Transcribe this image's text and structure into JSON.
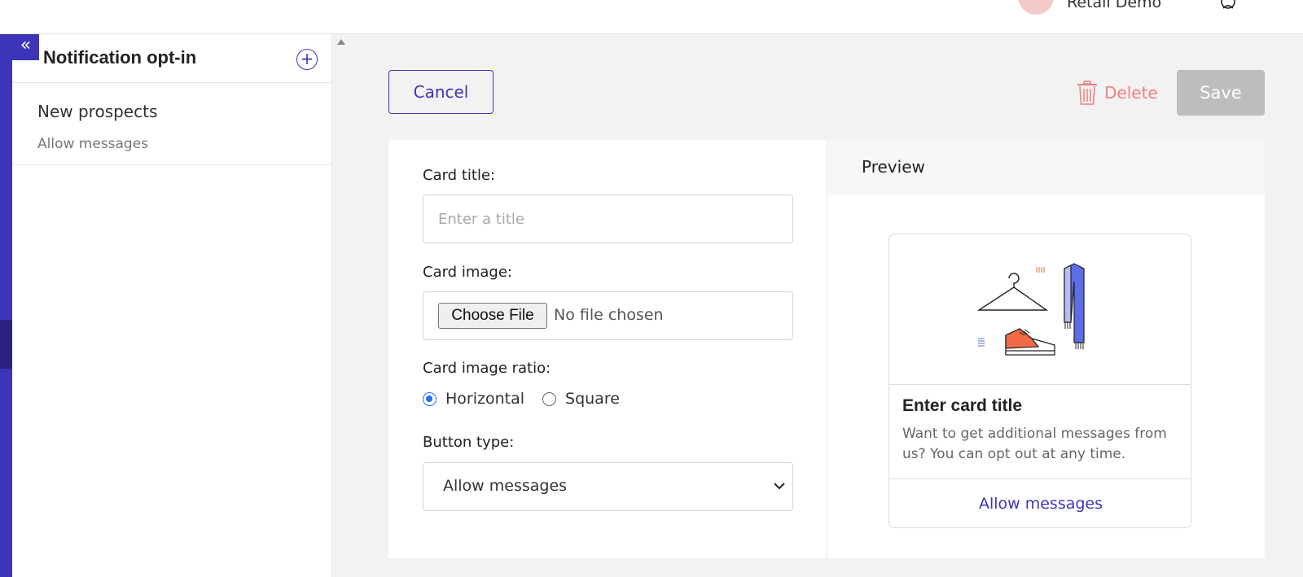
{
  "header": {
    "account_name": "Retail Demo",
    "avatar_icon": "avatar-circle",
    "user_icon": "user-icon"
  },
  "sidebar": {
    "collapse_icon": "double-chevron-left-icon",
    "title": "Notification opt-in",
    "add_icon": "plus-circle-icon",
    "items": [
      {
        "name": "New prospects",
        "subtitle": "Allow messages"
      }
    ]
  },
  "toolbar": {
    "cancel_label": "Cancel",
    "delete_label": "Delete",
    "save_label": "Save"
  },
  "form": {
    "card_title_label": "Card title:",
    "card_title_placeholder": "Enter a title",
    "card_title_value": "",
    "card_image_label": "Card image:",
    "choose_file_label": "Choose File",
    "file_status": "No file chosen",
    "ratio_label": "Card image ratio:",
    "ratio_options": [
      "Horizontal",
      "Square"
    ],
    "ratio_selected": "Horizontal",
    "button_type_label": "Button type:",
    "button_type_value": "Allow messages"
  },
  "preview": {
    "heading": "Preview",
    "card_title": "Enter card title",
    "card_text": "Want to get additional messages from us? You can opt out at any time.",
    "card_button": "Allow messages"
  },
  "colors": {
    "brand": "#3d35b9",
    "delete": "#f08080",
    "save_disabled": "#bdbdbd",
    "radio_checked": "#1a73e8",
    "illustration_accent": "#f26a45",
    "illustration_blue": "#5b6ee8"
  }
}
